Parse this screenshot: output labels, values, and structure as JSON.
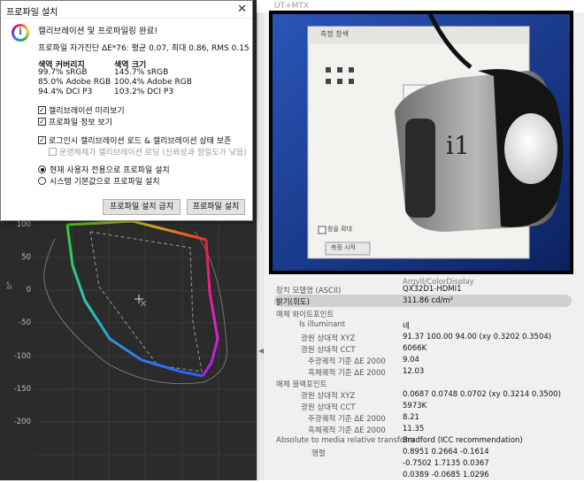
{
  "dialog": {
    "title": "프로파일 설치",
    "close_glyph": "✕",
    "headline": "캘리브레이션 및 프로파일링 완료!",
    "summary": "프로파일 자가진단 ΔE*76: 평균 0.07, 최대 0.86, RMS 0.15",
    "coverage_header": "색역 커버리지",
    "volume_header": "색역 크기",
    "coverage": [
      "99.7% sRGB",
      "85.0% Adobe RGB",
      "94.4% DCI P3"
    ],
    "volume": [
      "145.7% sRGB",
      "100.4% Adobe RGB",
      "103.2% DCI P3"
    ],
    "checkboxes": [
      {
        "label": "캘리브레이션 미리보기",
        "checked": true,
        "disabled": false
      },
      {
        "label": "프로파일 정보 보기",
        "checked": true,
        "disabled": false
      },
      {
        "label": "로그인시 캘리브레이션 로드 & 캘리브레이션 상태 보존",
        "checked": true,
        "disabled": false
      },
      {
        "label": "운영체제가 캘리브레이션 로딩 (신뢰성과 정밀도가 낮음)",
        "checked": false,
        "disabled": true
      }
    ],
    "radios": [
      {
        "label": "현재 사용자 전용으로 프로파일 설치",
        "selected": true
      },
      {
        "label": "시스템 기본값으로 프로파일 설치",
        "selected": false
      }
    ],
    "buttons": {
      "no_install": "프로파일 설치 금지",
      "install": "프로파일 설치"
    }
  },
  "background_title": "UT+MTX",
  "plot": {
    "yticks": [
      "100",
      "50",
      "0",
      "-50",
      "-100",
      "-150",
      "-200"
    ],
    "y_label": "b*"
  },
  "photo": {
    "window_title": "측정 창색",
    "checkbox_label": "창을 확대",
    "button_label": "측정 시작",
    "device_text": "i1"
  },
  "props": {
    "partial_row": "Argyll/ColorDisplay",
    "device_model_label": "장치 모델명 (ASCII)",
    "device_model_value": "QX32D1-HDMI1",
    "luminance_label": "밝기(휘도)",
    "luminance_value": "311.86 cd/m²",
    "white_section": "매체 화이트포인트",
    "illuminant_label": "Is illuminant",
    "illuminant_value": "네",
    "xyz_label": "광원 상대적 XYZ",
    "white_xyz_value": "91.37 100.00  94.00 (xy 0.3202 0.3504)",
    "cct_label": "광원 상대적 CCT",
    "white_cct_value": "6066K",
    "planck_label": "주광궤적 기준 ΔE 2000",
    "white_planck_value": "9.04",
    "blackbody_label": "흑체궤적 기준 ΔE 2000",
    "white_blackbody_value": "12.03",
    "black_section": "매체 블랙포인트",
    "black_xyz_value": "0.0687 0.0748 0.0702 (xy 0.3214 0.3500)",
    "black_cct_value": "5973K",
    "black_planck_value": "8.21",
    "black_blackbody_value": "11.35",
    "transform_label": "Absolute to media relative transform",
    "transform_value": "Bradford (ICC recommendation)",
    "matrix_label": "행렬",
    "matrix": [
      "0.8951  0.2664  -0.1614",
      "-0.7502  1.7135  0.0367",
      "0.0389  -0.0685  1.0296"
    ]
  }
}
